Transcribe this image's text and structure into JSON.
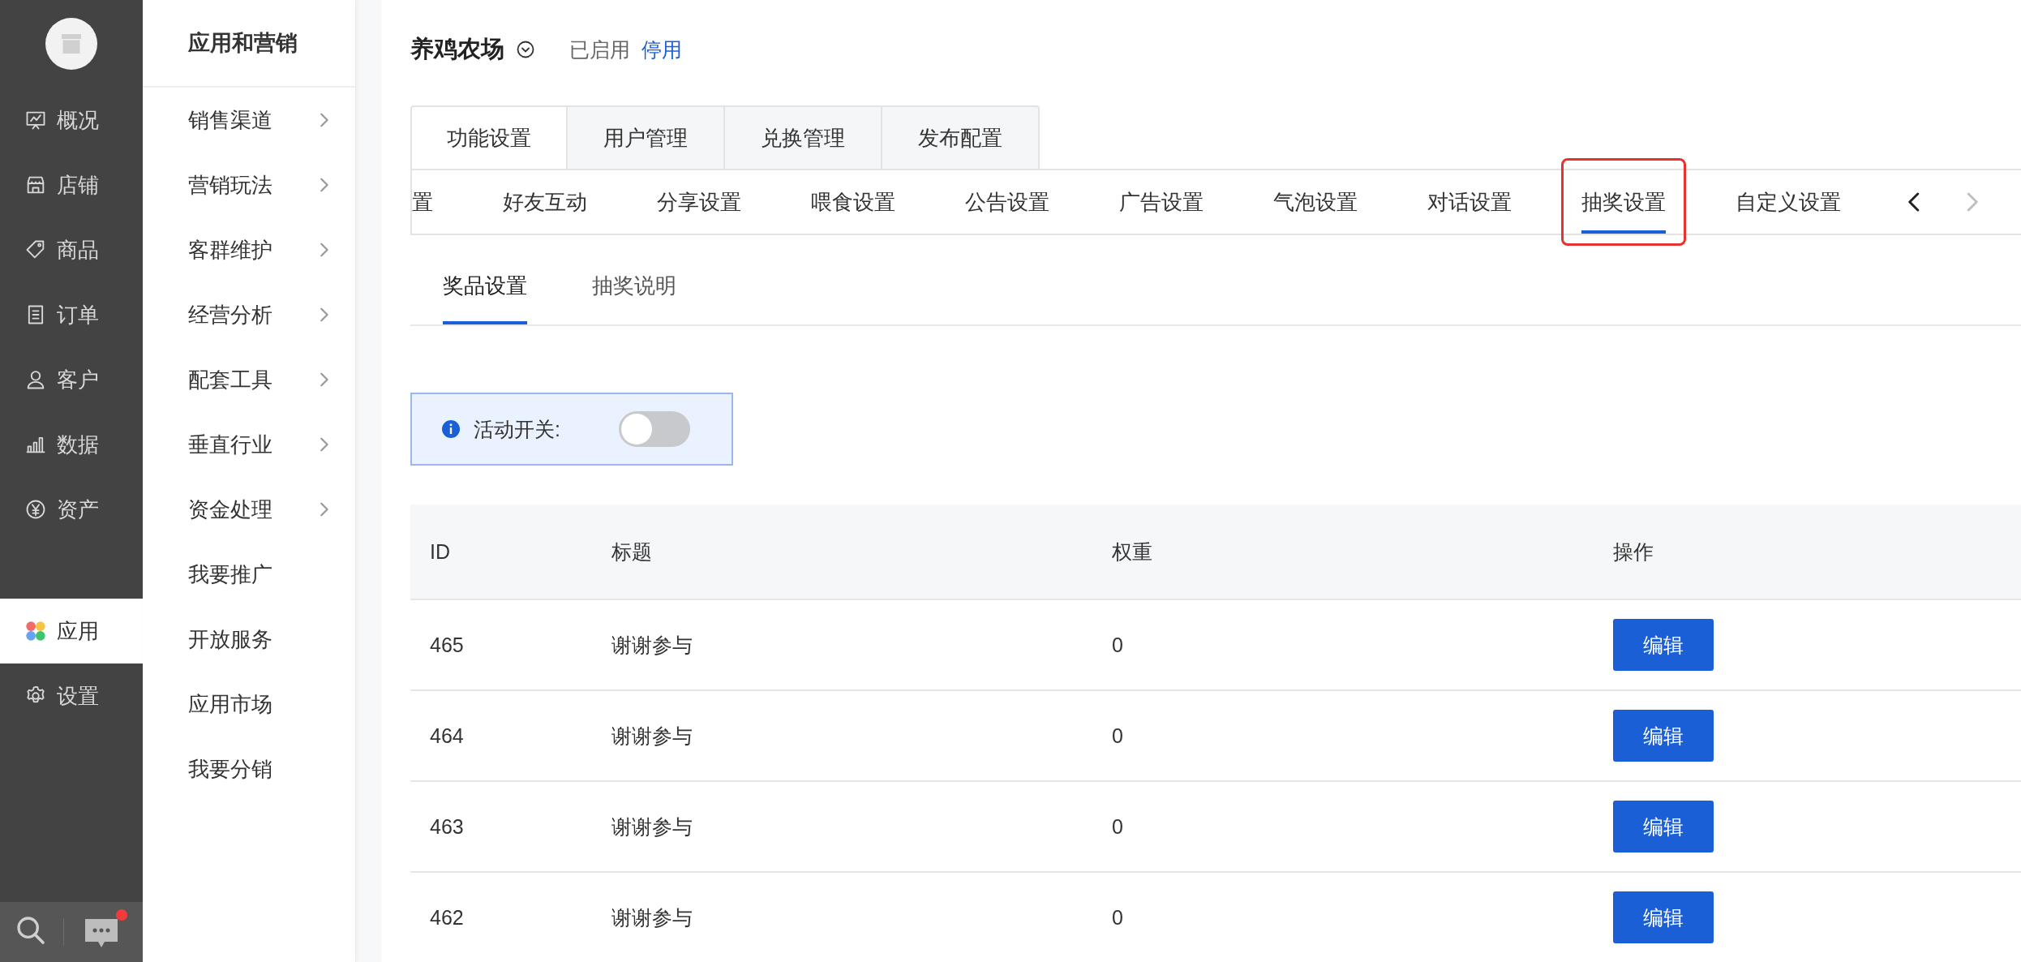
{
  "rail": {
    "items": [
      {
        "label": "概况",
        "selected": false
      },
      {
        "label": "店铺",
        "selected": false
      },
      {
        "label": "商品",
        "selected": false
      },
      {
        "label": "订单",
        "selected": false
      },
      {
        "label": "客户",
        "selected": false
      },
      {
        "label": "数据",
        "selected": false
      },
      {
        "label": "资产",
        "selected": false
      }
    ],
    "bottom_items": [
      {
        "label": "应用",
        "selected": true
      },
      {
        "label": "设置",
        "selected": false
      }
    ],
    "chat": {
      "unread": true
    }
  },
  "submenu": {
    "title": "应用和营销",
    "items": [
      {
        "label": "销售渠道",
        "expandable": true
      },
      {
        "label": "营销玩法",
        "expandable": true
      },
      {
        "label": "客群维护",
        "expandable": true
      },
      {
        "label": "经营分析",
        "expandable": true
      },
      {
        "label": "配套工具",
        "expandable": true
      },
      {
        "label": "垂直行业",
        "expandable": true
      },
      {
        "label": "资金处理",
        "expandable": true
      },
      {
        "label": "我要推广",
        "expandable": false
      },
      {
        "label": "开放服务",
        "expandable": false
      },
      {
        "label": "应用市场",
        "expandable": false
      },
      {
        "label": "我要分销",
        "expandable": false
      }
    ]
  },
  "app": {
    "name": "养鸡农场",
    "status": "已启用",
    "action": "停用"
  },
  "tabs": [
    {
      "label": "功能设置",
      "selected": true
    },
    {
      "label": "用户管理",
      "selected": false
    },
    {
      "label": "兑换管理",
      "selected": false
    },
    {
      "label": "发布配置",
      "selected": false
    }
  ],
  "settings_tabs": {
    "items": [
      {
        "label": "置",
        "selected": false,
        "highlighted": false
      },
      {
        "label": "好友互动",
        "selected": false,
        "highlighted": false
      },
      {
        "label": "分享设置",
        "selected": false,
        "highlighted": false
      },
      {
        "label": "喂食设置",
        "selected": false,
        "highlighted": false
      },
      {
        "label": "公告设置",
        "selected": false,
        "highlighted": false
      },
      {
        "label": "广告设置",
        "selected": false,
        "highlighted": false
      },
      {
        "label": "气泡设置",
        "selected": false,
        "highlighted": false
      },
      {
        "label": "对话设置",
        "selected": false,
        "highlighted": false
      },
      {
        "label": "抽奖设置",
        "selected": true,
        "highlighted": true
      },
      {
        "label": "自定义设置",
        "selected": false,
        "highlighted": false
      }
    ],
    "prev_disabled": false,
    "next_disabled": true
  },
  "prize_tabs": [
    {
      "label": "奖品设置",
      "selected": true
    },
    {
      "label": "抽奖说明",
      "selected": false
    }
  ],
  "activity_switch": {
    "label": "活动开关:",
    "on": false
  },
  "table": {
    "columns": [
      "ID",
      "标题",
      "权重",
      "操作"
    ],
    "rows": [
      {
        "id": "465",
        "title": "谢谢参与",
        "weight": "0",
        "action": "编辑"
      },
      {
        "id": "464",
        "title": "谢谢参与",
        "weight": "0",
        "action": "编辑"
      },
      {
        "id": "463",
        "title": "谢谢参与",
        "weight": "0",
        "action": "编辑"
      },
      {
        "id": "462",
        "title": "谢谢参与",
        "weight": "0",
        "action": "编辑"
      }
    ]
  }
}
